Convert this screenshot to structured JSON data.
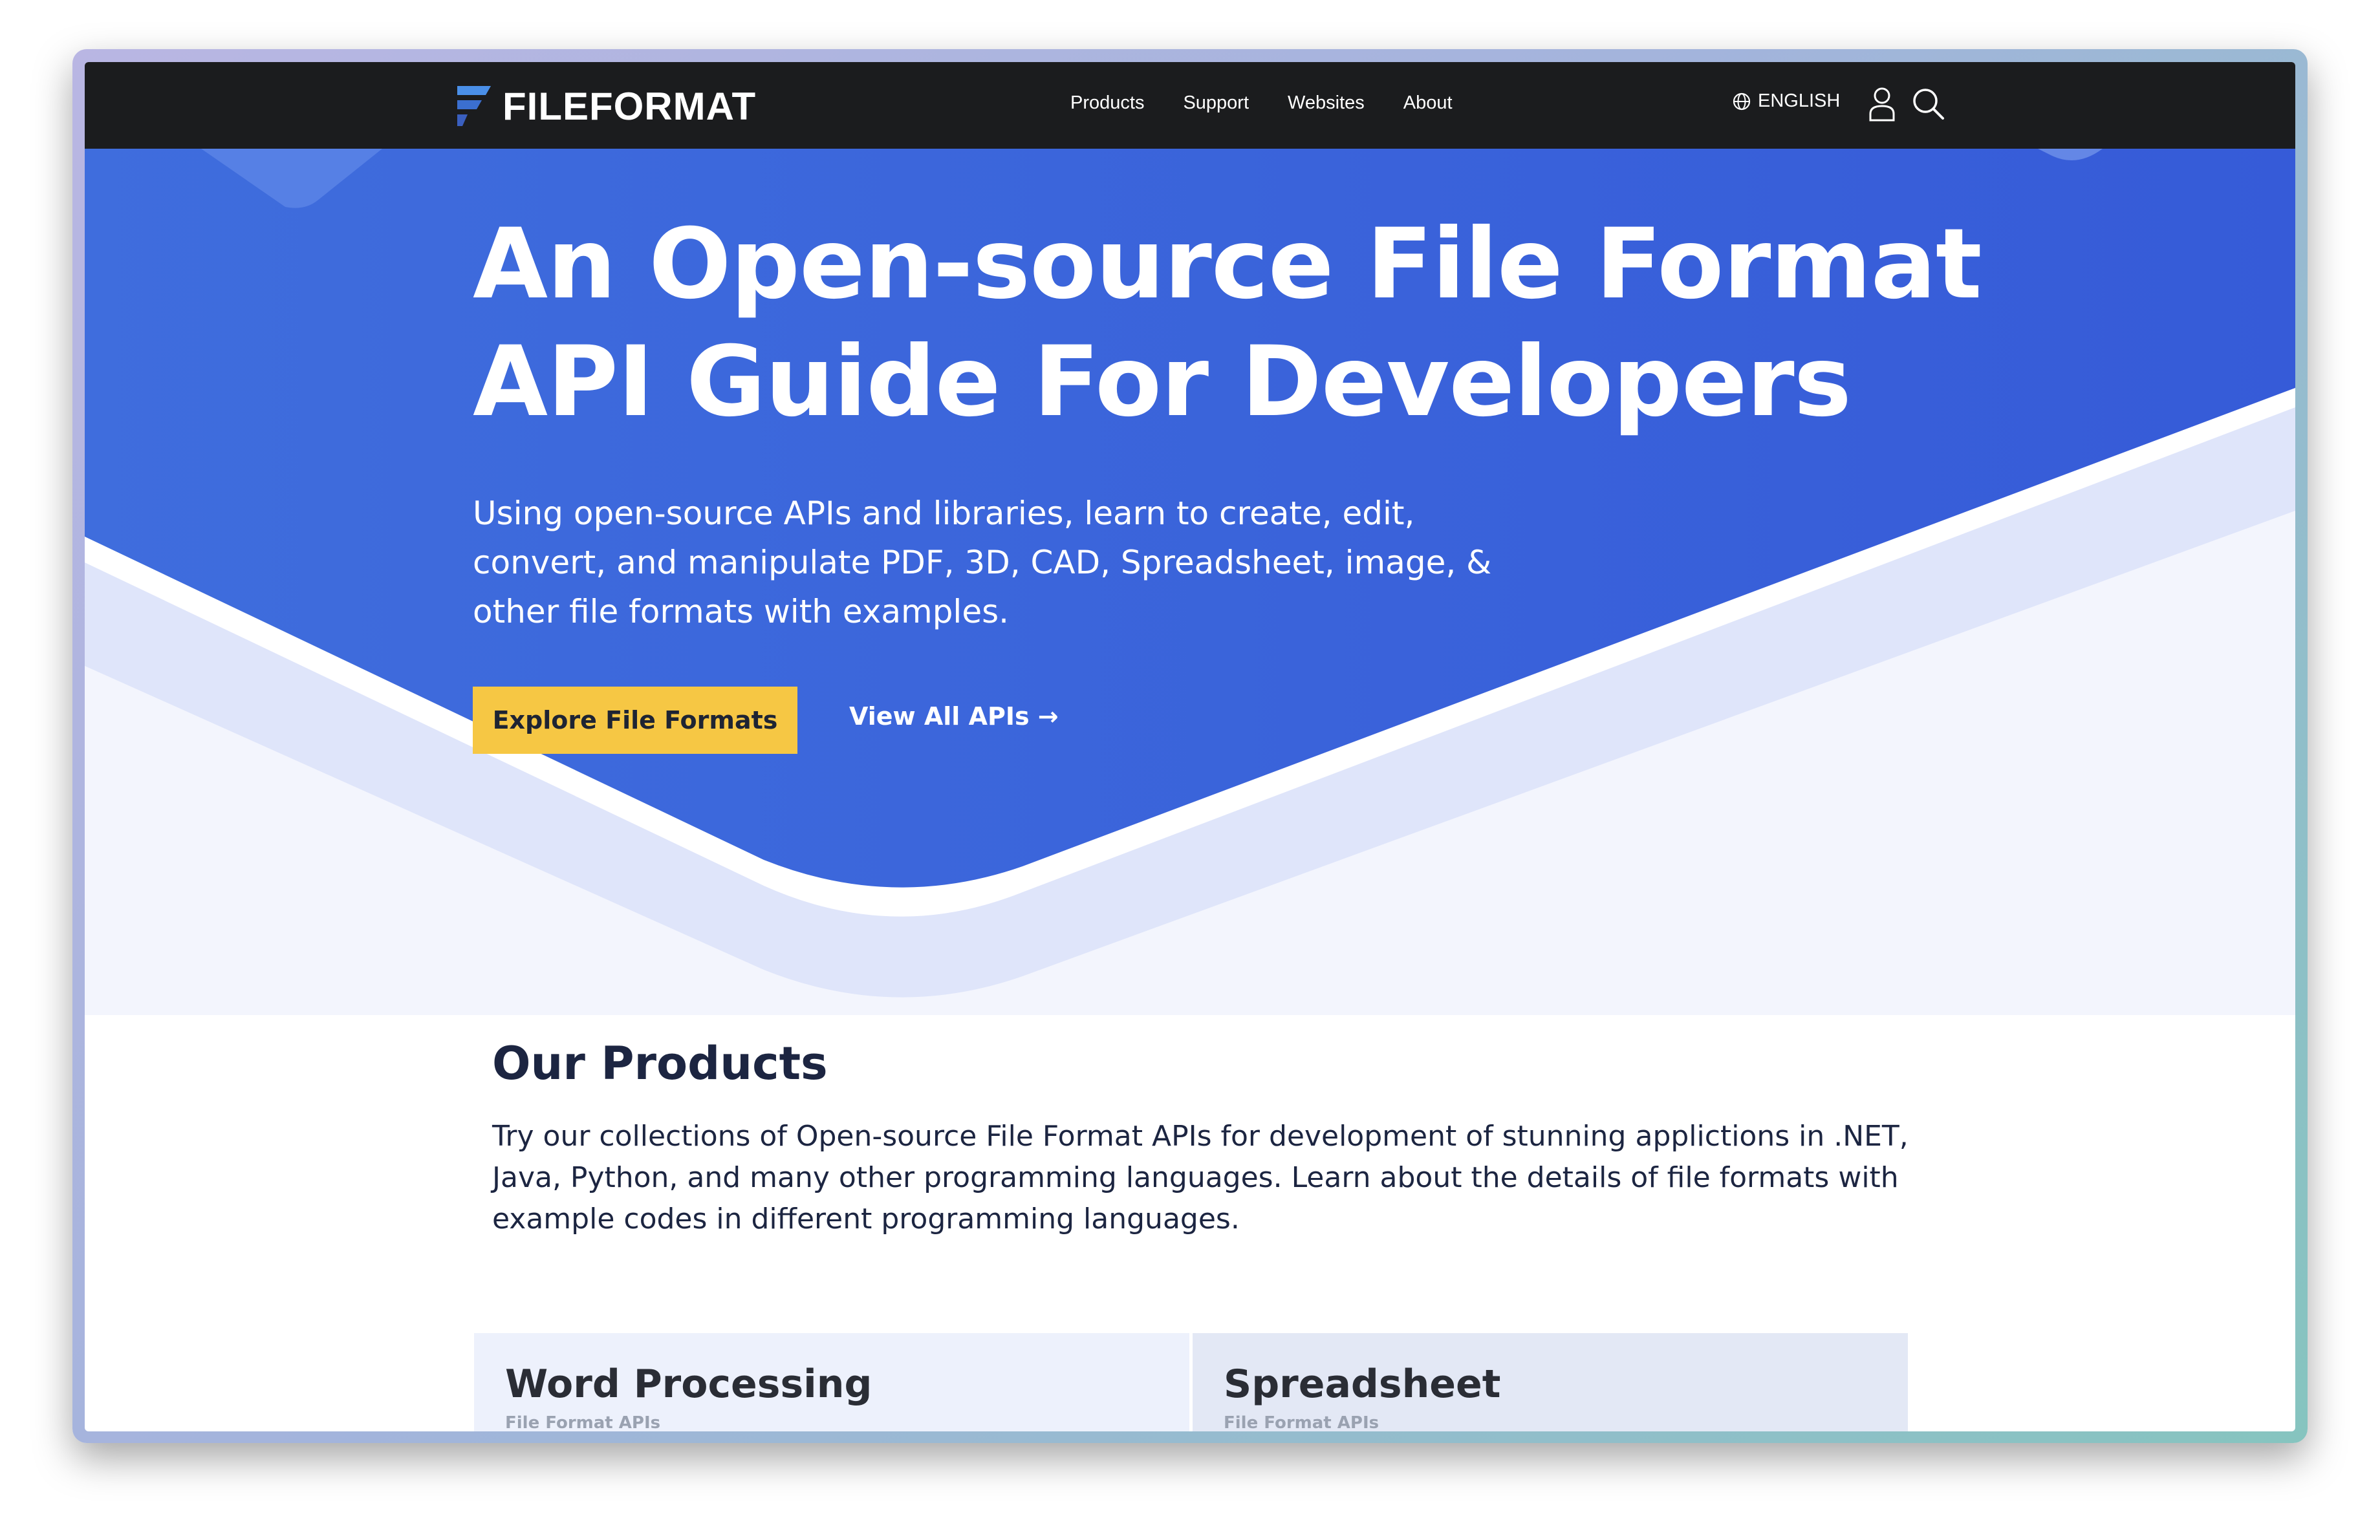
{
  "nav": {
    "logo_text": "FILEFORMAT",
    "links": [
      "Products",
      "Support",
      "Websites",
      "About"
    ],
    "language": "ENGLISH"
  },
  "hero": {
    "title": "An Open-source File Format API Guide For Developers",
    "subtitle": "Using open-source APIs and libraries, learn to create, edit, convert, and manipulate PDF, 3D, CAD, Spreadsheet, image, & other file formats with examples.",
    "primary_button": "Explore File Formats",
    "secondary_link": "View All APIs →"
  },
  "products": {
    "title": "Our Products",
    "description": "Try our collections of Open-source File Format APIs for development of stunning applictions in .NET, Java, Python, and many other programming languages. Learn about the details of file formats with example codes in different programming languages.",
    "cards": [
      {
        "title": "Word Processing",
        "subtitle": "File Format APIs"
      },
      {
        "title": "Spreadsheet",
        "subtitle": "File Format APIs"
      }
    ]
  },
  "colors": {
    "nav_bg": "#1b1c1e",
    "hero_blue": "#3a66dc",
    "button_yellow": "#f6c744",
    "heading_navy": "#1c2541"
  },
  "icons": [
    "fileformat-logo-icon",
    "globe-icon",
    "user-icon",
    "search-icon",
    "arrow-right-icon"
  ]
}
